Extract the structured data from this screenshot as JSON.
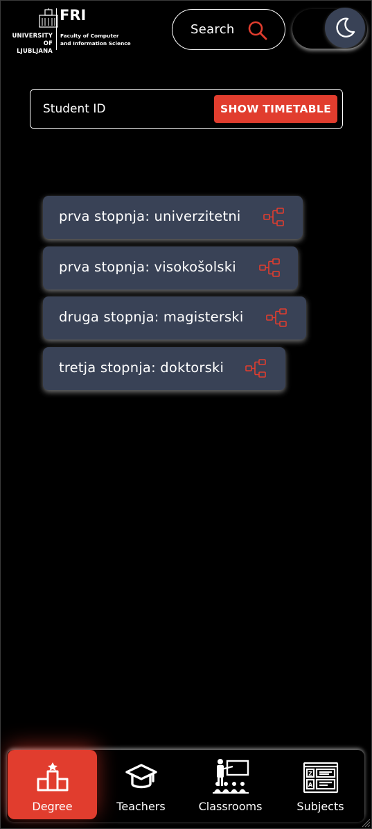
{
  "header": {
    "logo": {
      "university_line1": "UNIVERSITY",
      "university_line2": "OF LJUBLJANA",
      "acronym": "FRI",
      "faculty_line1": "Faculty of Computer",
      "faculty_line2": "and Information Science"
    },
    "search": {
      "label": "Search",
      "icon": "search-icon"
    },
    "theme_toggle": {
      "icon": "moon-icon",
      "mode": "dark"
    }
  },
  "student_form": {
    "placeholder": "Student ID",
    "value": "",
    "button_label": "SHOW TIMETABLE"
  },
  "degrees": [
    {
      "label": "prva stopnja: univerzitetni",
      "icon": "sitemap-icon"
    },
    {
      "label": "prva stopnja: visokošolski",
      "icon": "sitemap-icon"
    },
    {
      "label": "druga stopnja: magisterski",
      "icon": "sitemap-icon"
    },
    {
      "label": "tretja stopnja: doktorski",
      "icon": "sitemap-icon"
    }
  ],
  "bottom_nav": {
    "active": "Degree",
    "items": [
      {
        "label": "Degree",
        "icon": "podium-icon"
      },
      {
        "label": "Teachers",
        "icon": "graduation-cap-icon"
      },
      {
        "label": "Classrooms",
        "icon": "classroom-icon"
      },
      {
        "label": "Subjects",
        "icon": "subjects-icon"
      }
    ]
  },
  "colors": {
    "background": "#000000",
    "accent": "#e13d2e",
    "card": "#394256",
    "text": "#ffffff"
  }
}
